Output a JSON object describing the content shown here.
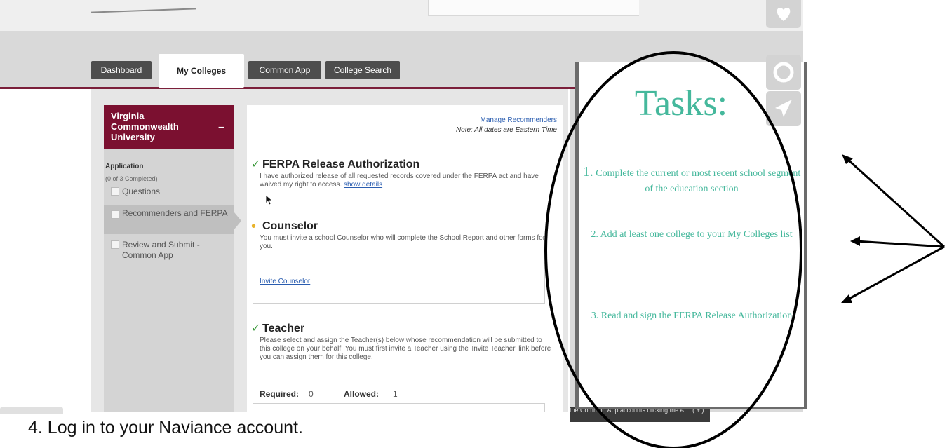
{
  "tabs": [
    {
      "label": "Dashboard",
      "active": false
    },
    {
      "label": "My Colleges",
      "active": true
    },
    {
      "label": "Common App",
      "active": false
    },
    {
      "label": "College Search",
      "active": false
    }
  ],
  "sidebar": {
    "college": "Virginia Commonwealth University",
    "collapse_symbol": "–",
    "section_label": "Application",
    "progress": "(0 of 3 Completed)",
    "items": [
      {
        "label": "Questions",
        "active": false
      },
      {
        "label": "Recommenders and FERPA",
        "active": true
      },
      {
        "label": "Review and Submit - Common App",
        "active": false
      }
    ]
  },
  "main": {
    "manage_link": "Manage Recommenders",
    "timezone_note": "Note: All dates are Eastern Time",
    "ferpa": {
      "title": "FERPA Release Authorization",
      "text": "I have authorized release of all requested records covered under the FERPA act and have waived my right to access.",
      "details_link": "show details"
    },
    "counselor": {
      "title": "Counselor",
      "text": "You must invite a school Counselor who will complete the School Report and other forms for you.",
      "invite_link": "Invite Counselor"
    },
    "teacher": {
      "title": "Teacher",
      "text": "Please select and assign the Teacher(s) below whose recommendation will be submitted to this college on your behalf. You must first invite a Teacher using the 'Invite Teacher' link before you can assign them for this college.",
      "required_label": "Required:",
      "required_value": "0",
      "allowed_label": "Allowed:",
      "allowed_value": "1"
    }
  },
  "tasks": {
    "title": "Tasks:",
    "items": [
      {
        "number": "1.",
        "text": "Complete the current or most recent school segment of the education section"
      },
      {
        "number": "2.",
        "text": "Add at least one college to your My Colleges list"
      },
      {
        "number": "3.",
        "text": "Read and sign the FERPA Release Authorization"
      }
    ]
  },
  "side_panel_text": "the Common App accounts clicking the A ... ( + )",
  "caption": "4.  Log in to your Naviance account.",
  "colors": {
    "maroon": "#7b1030",
    "tasks_teal": "#45b89c",
    "check_green": "#3d9a3d",
    "dot_yellow": "#e8b32b",
    "link_blue": "#2a5db0"
  },
  "icons": [
    "heart-icon",
    "refresh-icon",
    "send-icon",
    "check-icon",
    "cursor-icon"
  ]
}
